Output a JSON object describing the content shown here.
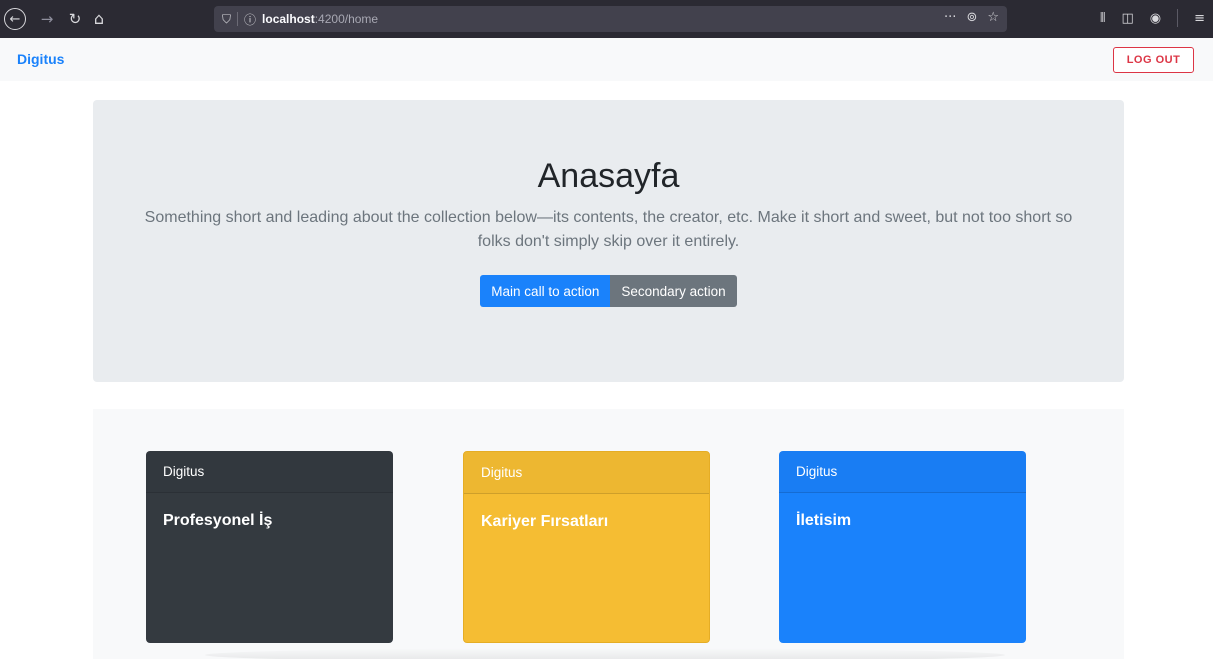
{
  "browser": {
    "url_host": "localhost",
    "url_path": ":4200/home"
  },
  "navbar": {
    "brand": "Digitus",
    "logout_label": "LOG OUT"
  },
  "jumbotron": {
    "title": "Anasayfa",
    "lead": "Something short and leading about the collection below—its contents, the creator, etc. Make it short and sweet, but not too short so folks don't simply skip over it entirely.",
    "primary_label": "Main call to action",
    "secondary_label": "Secondary action"
  },
  "cards": [
    {
      "header": "Digitus",
      "title": "Profesyonel İş",
      "color": "#343a40"
    },
    {
      "header": "Digitus",
      "title": "Kariyer Fırsatları",
      "color": "#f5bd33"
    },
    {
      "header": "Digitus",
      "title": "İletisim",
      "color": "#1a82fb"
    }
  ],
  "colors": {
    "primary": "#1a82fb",
    "secondary": "#6c757d",
    "danger": "#dc3545",
    "warning": "#f5bd33",
    "dark": "#343a40"
  }
}
